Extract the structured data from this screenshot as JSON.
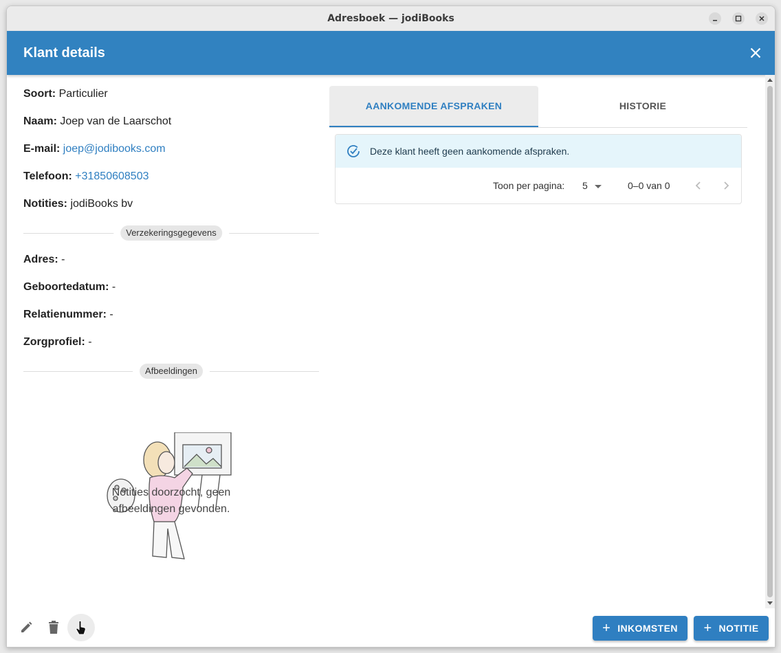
{
  "window": {
    "title": "Adresboek — jodiBooks"
  },
  "dialog": {
    "title": "Klant details"
  },
  "details": {
    "soort": {
      "label": "Soort:",
      "value": "Particulier"
    },
    "naam": {
      "label": "Naam:",
      "value": "Joep van de Laarschot"
    },
    "email": {
      "label": "E-mail:",
      "value": "joep@jodibooks.com"
    },
    "telefoon": {
      "label": "Telefoon:",
      "value": "+31850608503"
    },
    "notities": {
      "label": "Notities:",
      "value": "jodiBooks bv"
    }
  },
  "insurance": {
    "section_label": "Verzekeringsgegevens",
    "adres": {
      "label": "Adres:",
      "value": "-"
    },
    "geboortedatum": {
      "label": "Geboortedatum:",
      "value": "-"
    },
    "relatienummer": {
      "label": "Relatienummer:",
      "value": "-"
    },
    "zorgprofiel": {
      "label": "Zorgprofiel:",
      "value": "-"
    }
  },
  "images": {
    "section_label": "Afbeeldingen",
    "empty_line1": "Notities doorzocht, geen",
    "empty_line2": "afbeeldingen gevonden."
  },
  "tabs": [
    {
      "label": "AANKOMENDE AFSPRAKEN",
      "active": true
    },
    {
      "label": "HISTORIE",
      "active": false
    }
  ],
  "appointments": {
    "alert": "Deze klant heeft geen aankomende afspraken.",
    "per_page_label": "Toon per pagina:",
    "per_page_value": "5",
    "range": "0–0 van 0"
  },
  "actions": {
    "inkomsten": "INKOMSTEN",
    "notitie": "NOTITIE"
  },
  "colors": {
    "accent": "#3182c0",
    "info_bg": "#e5f5fb"
  }
}
